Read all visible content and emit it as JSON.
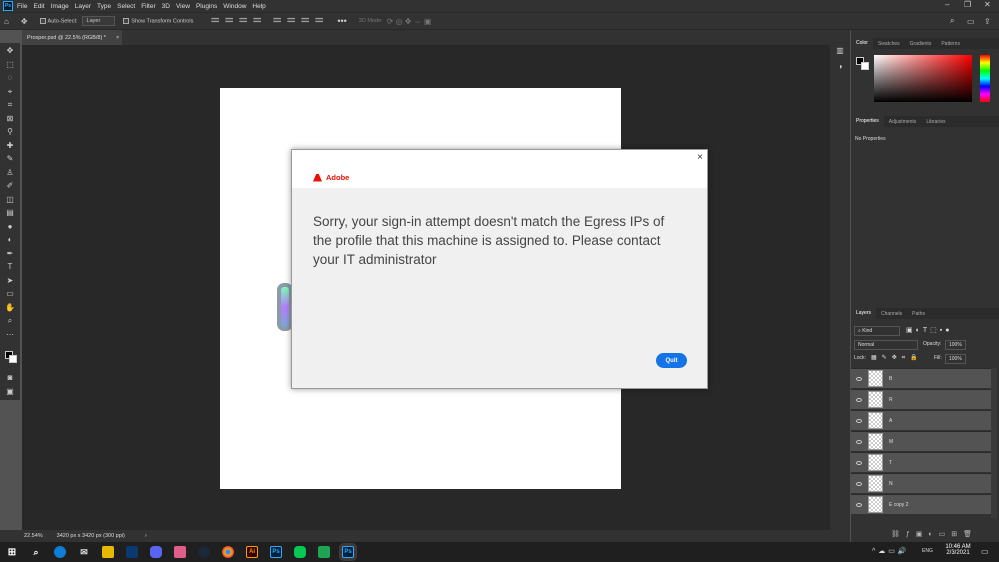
{
  "menu": {
    "logo": "Ps",
    "items": [
      "File",
      "Edit",
      "Image",
      "Layer",
      "Type",
      "Select",
      "Filter",
      "3D",
      "View",
      "Plugins",
      "Window",
      "Help"
    ]
  },
  "options": {
    "auto_select": "Auto-Select:",
    "layer_select": "Layer",
    "show_transform": "Show Transform Controls",
    "mode_3d": "3D Mode:"
  },
  "doc_tab": {
    "title": "Prosper.psd @ 22.5% (RGB/8) *",
    "close": "×"
  },
  "status": {
    "zoom": "22.54%",
    "size": "3420 px x 3420 px (300 ppi)",
    "arrow": "›"
  },
  "color_panel": {
    "tabs": [
      "Color",
      "Swatches",
      "Gradients",
      "Patterns"
    ]
  },
  "properties_panel": {
    "tabs": [
      "Properties",
      "Adjustments",
      "Libraries"
    ],
    "empty": "No Properties"
  },
  "layers_panel": {
    "tabs": [
      "Layers",
      "Channels",
      "Paths"
    ],
    "kind": "Kind",
    "blend": "Normal",
    "opacity_label": "Opacity:",
    "opacity": "100%",
    "lock_label": "Lock:",
    "fill_label": "Fill:",
    "fill": "100%",
    "layers": [
      "B",
      "R",
      "A",
      "M",
      "T",
      "N",
      "E copy 2"
    ]
  },
  "dialog": {
    "brand": "Adobe",
    "close": "×",
    "message": "Sorry, your sign-in attempt doesn't match the Egress IPs of the profile that this machine is assigned to. Please contact your IT administrator",
    "quit_label": "Quit"
  },
  "taskbar": {
    "time": "10:46 AM",
    "date": "2/3/2021",
    "lang": "ENG",
    "apps": [
      "Ai",
      "Ps",
      "Ps"
    ]
  },
  "colors": {
    "accent": "#1473e6",
    "adobe_red": "#eb1000"
  }
}
